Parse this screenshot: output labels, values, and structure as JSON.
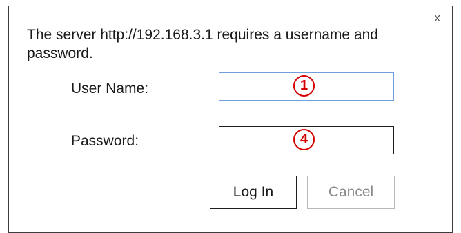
{
  "dialog": {
    "close_label": "x",
    "message": "The server http://192.168.3.1 requires a username and password.",
    "username_label": "User Name:",
    "password_label": "Password:",
    "username_value": "",
    "password_value": "",
    "username_marker": "1",
    "password_marker": "4",
    "login_label": "Log In",
    "cancel_label": "Cancel",
    "marker_color": "#d40000",
    "focus_border_color": "#6f9fd8"
  }
}
